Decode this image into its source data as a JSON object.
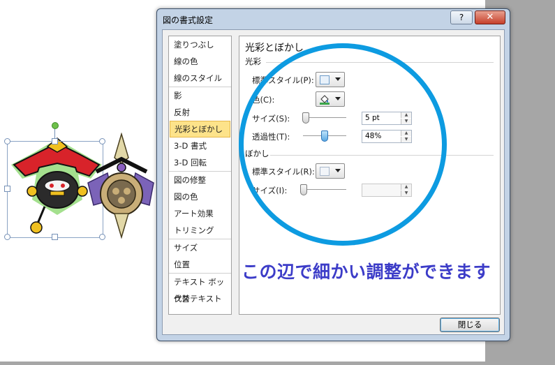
{
  "dialog": {
    "title": "図の書式設定",
    "help_label": "?",
    "close_symbol": "✕",
    "close_button": "閉じる"
  },
  "nav": {
    "items": [
      "塗りつぶし",
      "線の色",
      "線のスタイル",
      "影",
      "反射",
      "光彩とぼかし",
      "3-D 書式",
      "3-D 回転",
      "図の修整",
      "図の色",
      "アート効果",
      "トリミング",
      "サイズ",
      "位置",
      "テキスト ボックス",
      "代替テキスト"
    ],
    "active_index": 5
  },
  "panel": {
    "title": "光彩とぼかし",
    "glow": {
      "section": "光彩",
      "preset_label": "標準スタイル(P):",
      "color_label": "色(C):",
      "size_label": "サイズ(S):",
      "size_value": "5 pt",
      "size_slider_fraction": 0.05,
      "transparency_label": "透過性(T):",
      "transparency_value": "48%",
      "transparency_slider_fraction": 0.48
    },
    "soft_edges": {
      "section": "ぼかし",
      "preset_label": "標準スタイル(R):",
      "size_label": "サイズ(I):",
      "size_value": "",
      "size_slider_fraction": 0.0
    }
  },
  "annotation": {
    "text": "この辺で細かい調整ができます",
    "color": "#3c3cc8",
    "circle_color": "#0d9be1"
  },
  "colors": {
    "glow_color": "#3aa64a"
  }
}
